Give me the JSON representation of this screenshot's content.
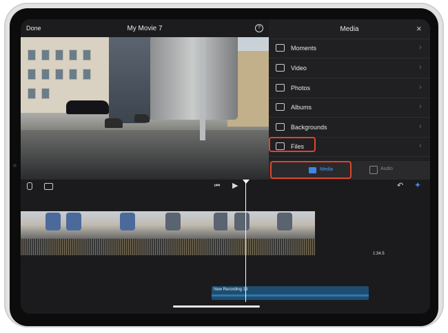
{
  "editor": {
    "done_label": "Done",
    "title": "My Movie 7",
    "help_icon": "?"
  },
  "media_panel": {
    "title": "Media",
    "close_icon": "×",
    "items": [
      {
        "label": "Moments",
        "icon": "moments-icon"
      },
      {
        "label": "Video",
        "icon": "video-icon"
      },
      {
        "label": "Photos",
        "icon": "photos-icon"
      },
      {
        "label": "Albums",
        "icon": "albums-icon"
      },
      {
        "label": "Backgrounds",
        "icon": "backgrounds-icon"
      },
      {
        "label": "Files",
        "icon": "folder-icon"
      }
    ],
    "tabs": {
      "media_label": "Media",
      "audio_label": "Audio"
    }
  },
  "timeline": {
    "clip_duration": "1:34.5",
    "recording_label": "New Recording 13"
  },
  "colors": {
    "accent": "#3f86e8",
    "highlight": "#e0452c",
    "recording": "#1d4e72"
  }
}
